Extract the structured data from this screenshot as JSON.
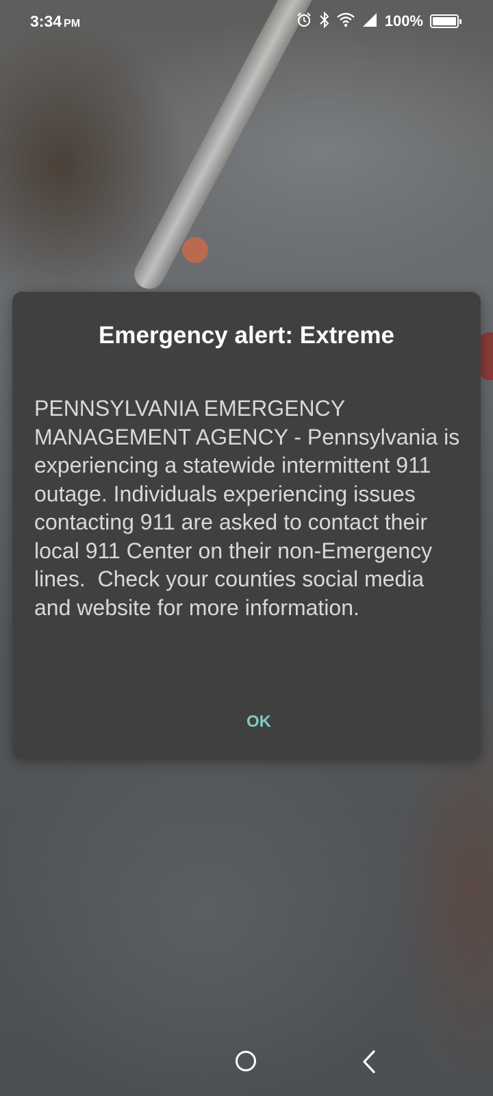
{
  "status_bar": {
    "time": "3:34",
    "ampm": "PM",
    "battery_percent": "100%",
    "icons": [
      "alarm-icon",
      "bluetooth-icon",
      "wifi-icon",
      "signal-icon",
      "battery-icon"
    ]
  },
  "alert_dialog": {
    "title": "Emergency alert: Extreme",
    "message": "PENNSYLVANIA EMERGENCY MANAGEMENT AGENCY - Pennsylvania is experiencing a statewide intermittent 911 outage. Individuals experiencing issues contacting 911 are asked to contact their local 911 Center on their non-Emergency lines.  Check your counties social media and website for more information.",
    "ok_label": "OK"
  },
  "nav_bar": {
    "buttons": [
      "home-button",
      "back-button"
    ]
  },
  "colors": {
    "dialog_background": "#404040",
    "title_text": "#ffffff",
    "body_text": "#d8d8d8",
    "accent": "#80cbc4"
  }
}
